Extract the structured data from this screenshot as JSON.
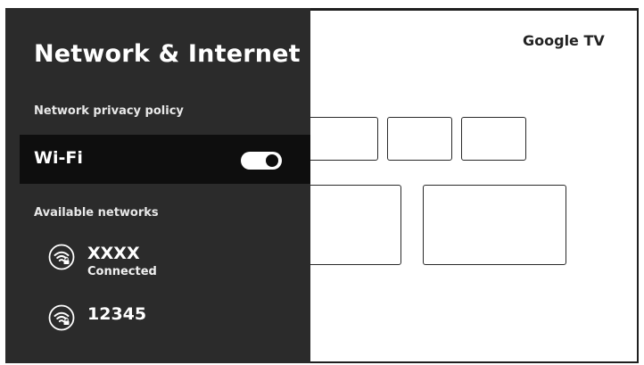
{
  "settings_panel": {
    "title": "Network & Internet",
    "privacy_label": "Network privacy policy",
    "wifi": {
      "label": "Wi-Fi",
      "enabled": true
    },
    "available_label": "Available networks",
    "networks": [
      {
        "name": "XXXX",
        "status": "Connected",
        "icon": "wifi-lock-icon"
      },
      {
        "name": "12345",
        "status": "",
        "icon": "wifi-lock-icon"
      }
    ]
  },
  "background": {
    "brand": "Google TV"
  },
  "colors": {
    "panel_bg": "#2b2b2b",
    "selected_row_bg": "#0e0e0e",
    "text": "#ffffff",
    "screen_bg": "#ffffff"
  }
}
